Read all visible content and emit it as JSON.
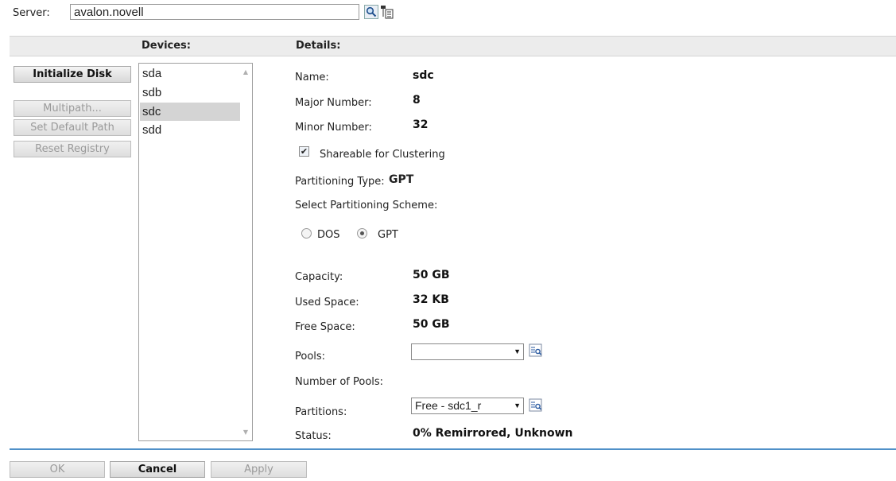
{
  "server": {
    "label": "Server:",
    "value": "avalon.novell",
    "search_icon": "magnifier-icon",
    "browse_icon": "tree-browse-icon"
  },
  "columns": {
    "devices": "Devices:",
    "details": "Details:"
  },
  "actions": {
    "initialize_disk": "Initialize Disk",
    "multipath": "Multipath...",
    "set_default_path": "Set Default Path",
    "reset_registry": "Reset Registry"
  },
  "devices": [
    {
      "label": "sda"
    },
    {
      "label": "sdb"
    },
    {
      "label": "sdc",
      "selected": true
    },
    {
      "label": "sdd"
    }
  ],
  "details": {
    "name_label": "Name:",
    "name_value": "sdc",
    "major_label": "Major Number:",
    "major_value": "8",
    "minor_label": "Minor Number:",
    "minor_value": "32",
    "shareable_label": "Shareable for Clustering",
    "shareable_checked": true,
    "ptype_label": "Partitioning Type:",
    "ptype_value": "GPT",
    "scheme_label": "Select Partitioning Scheme:",
    "scheme_options": [
      "DOS",
      "GPT"
    ],
    "scheme_selected": "GPT",
    "capacity_label": "Capacity:",
    "capacity_value": "50 GB",
    "used_label": "Used Space:",
    "used_value": "32 KB",
    "free_label": "Free Space:",
    "free_value": "50 GB",
    "pools_label": "Pools:",
    "pools_value": "",
    "num_pools_label": "Number of Pools:",
    "partitions_label": "Partitions:",
    "partitions_value": "Free - sdc1_r",
    "status_label": "Status:",
    "status_value": "0% Remirrored, Unknown"
  },
  "footer": {
    "ok": "OK",
    "cancel": "Cancel",
    "apply": "Apply"
  },
  "colors": {
    "accent_line": "#4f90c8",
    "header_bg": "#ececec",
    "selected_row": "#d4d4d4"
  }
}
